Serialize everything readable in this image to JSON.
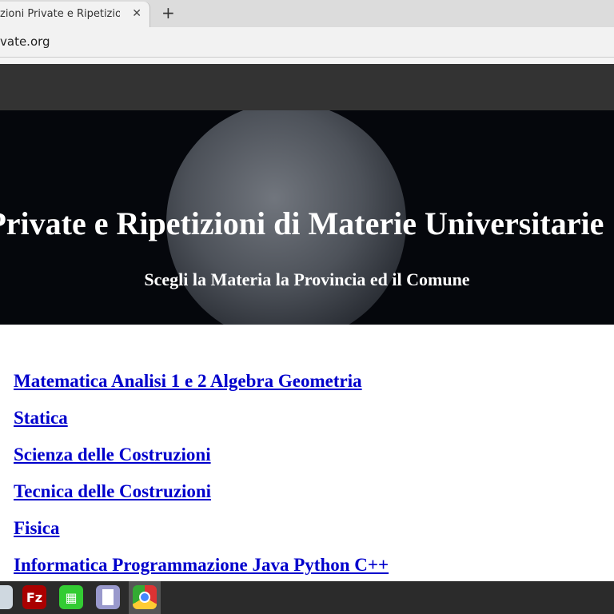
{
  "browser": {
    "tab_title": "zioni Private e Ripetizioni di Materie Universitarie",
    "url": "vate.org",
    "new_tab": "+",
    "close": "✕"
  },
  "hero": {
    "title": "ni Private e Ripetizioni di Materie Universitarie",
    "subtitle": "Scegli la Materia la Provincia ed il Comune"
  },
  "links": [
    "Matematica Analisi 1 e 2 Algebra Geometria",
    "Statica",
    "Scienza delle Costruzioni",
    "Tecnica delle Costruzioni",
    "Fisica",
    "Informatica Programmazione Java Python C++"
  ],
  "taskbar": {
    "filezilla_label": "Fz"
  }
}
